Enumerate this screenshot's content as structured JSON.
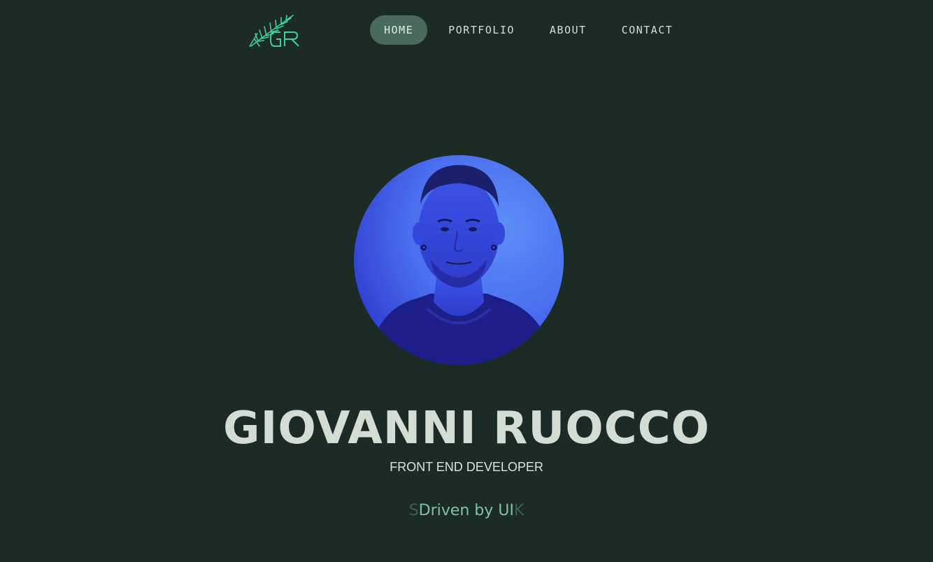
{
  "header": {
    "logo_icon": "fern-leaf-gr-monogram-icon"
  },
  "nav": {
    "items": [
      {
        "label": "HOME",
        "active": true
      },
      {
        "label": "PORTFOLIO",
        "active": false
      },
      {
        "label": "ABOUT",
        "active": false
      },
      {
        "label": "CONTACT",
        "active": false
      }
    ]
  },
  "hero": {
    "photo_icon": "profile-photo",
    "name": "GIOVANNI RUOCCO",
    "role": "FRONT END DEVELOPER",
    "tagline_ghost_left": "S",
    "tagline": "Driven by UI",
    "tagline_ghost_right": "K"
  },
  "colors": {
    "background": "#1d2b26",
    "accent": "#4a6b5c",
    "tagline": "#7cc4a3",
    "text": "#d3ddd3",
    "photo_tint": "#3a4de0"
  }
}
